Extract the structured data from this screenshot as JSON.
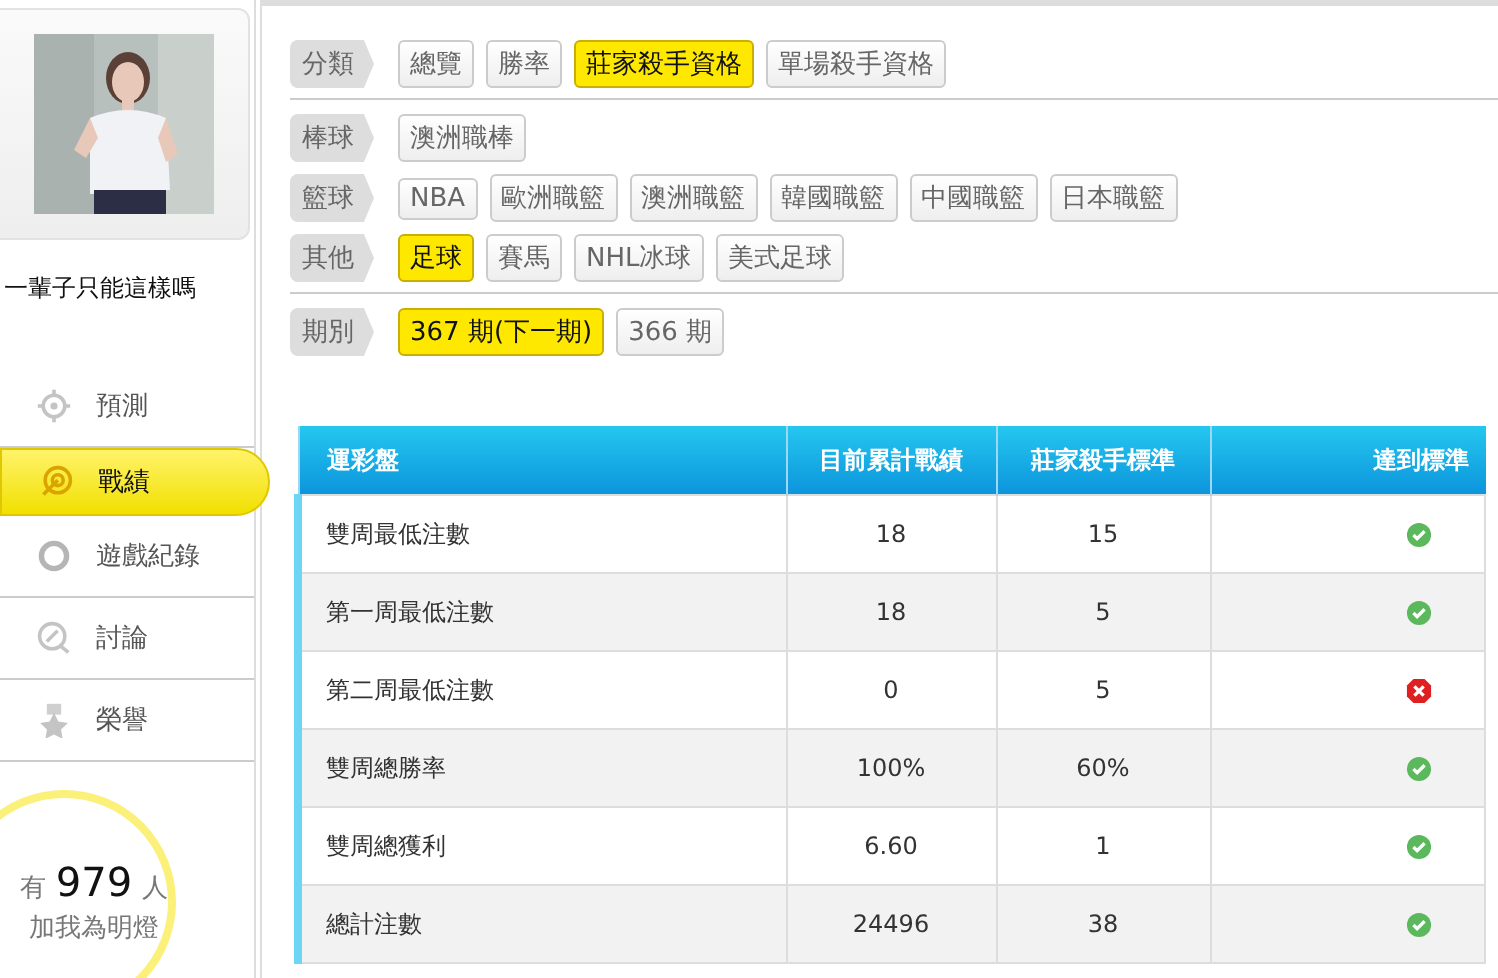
{
  "profile": {
    "name": "一輩子只能這樣嗎",
    "fans_prefix": "有",
    "fans_count": "979",
    "fans_suffix": "人",
    "fans_caption": "加我為明燈"
  },
  "menu": [
    {
      "label": "預測",
      "selected": false
    },
    {
      "label": "戰績",
      "selected": true
    },
    {
      "label": "遊戲紀錄",
      "selected": false
    },
    {
      "label": "討論",
      "selected": false
    },
    {
      "label": "榮譽",
      "selected": false
    }
  ],
  "filter_sections": [
    [
      {
        "label": "分類",
        "options": [
          {
            "text": "總覽",
            "selected": false
          },
          {
            "text": "勝率",
            "selected": false
          },
          {
            "text": "莊家殺手資格",
            "selected": true
          },
          {
            "text": "單場殺手資格",
            "selected": false
          }
        ]
      }
    ],
    [
      {
        "label": "棒球",
        "options": [
          {
            "text": "澳洲職棒",
            "selected": false
          }
        ]
      },
      {
        "label": "籃球",
        "options": [
          {
            "text": "NBA",
            "selected": false
          },
          {
            "text": "歐洲職籃",
            "selected": false
          },
          {
            "text": "澳洲職籃",
            "selected": false
          },
          {
            "text": "韓國職籃",
            "selected": false
          },
          {
            "text": "中國職籃",
            "selected": false
          },
          {
            "text": "日本職籃",
            "selected": false
          }
        ]
      },
      {
        "label": "其他",
        "options": [
          {
            "text": "足球",
            "selected": true
          },
          {
            "text": "賽馬",
            "selected": false
          },
          {
            "text": "NHL冰球",
            "selected": false
          },
          {
            "text": "美式足球",
            "selected": false
          }
        ]
      }
    ],
    [
      {
        "label": "期別",
        "options": [
          {
            "text": "367 期(下一期)",
            "selected": true
          },
          {
            "text": "366 期",
            "selected": false
          }
        ]
      }
    ]
  ],
  "table": {
    "columns": [
      "運彩盤",
      "目前累計戰績",
      "莊家殺手標準",
      "達到標準"
    ],
    "rows": [
      {
        "name": "雙周最低注數",
        "current": "18",
        "standard": "15",
        "met": true
      },
      {
        "name": "第一周最低注數",
        "current": "18",
        "standard": "5",
        "met": true
      },
      {
        "name": "第二周最低注數",
        "current": "0",
        "standard": "5",
        "met": false
      },
      {
        "name": "雙周總勝率",
        "current": "100%",
        "standard": "60%",
        "met": true
      },
      {
        "name": "雙周總獲利",
        "current": "6.60",
        "standard": "1",
        "met": true
      },
      {
        "name": "總計注數",
        "current": "24496",
        "standard": "38",
        "met": true
      }
    ]
  }
}
